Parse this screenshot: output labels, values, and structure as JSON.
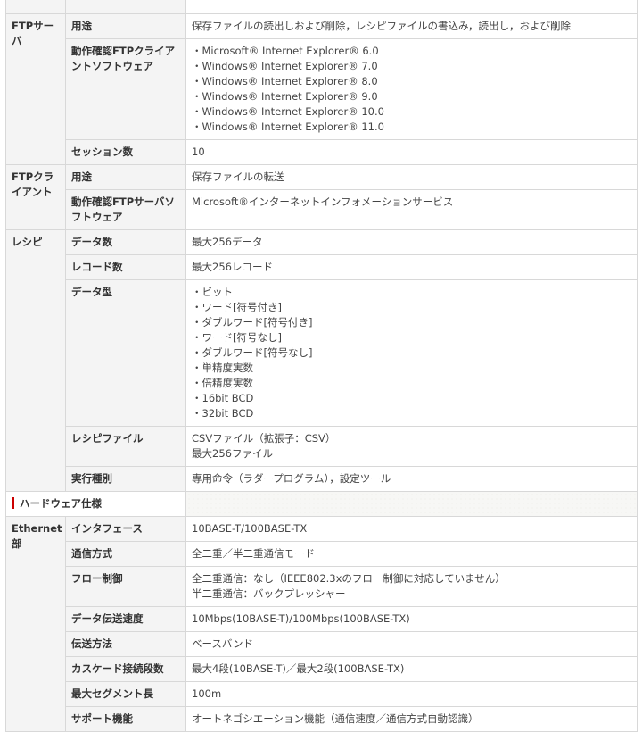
{
  "ftp_server": {
    "category": "FTPサーバ",
    "rows": [
      {
        "label": "用途",
        "lines": [
          "保存ファイルの読出しおよび削除，レシピファイルの書込み，読出し，および削除"
        ]
      },
      {
        "label": "動作確認FTPクライアントソフトウェア",
        "lines": [
          "・Microsoft® Internet Explorer® 6.0",
          "・Windows® Internet Explorer® 7.0",
          "・Windows® Internet Explorer® 8.0",
          "・Windows® Internet Explorer® 9.0",
          "・Windows® Internet Explorer® 10.0",
          "・Windows® Internet Explorer® 11.0"
        ]
      },
      {
        "label": "セッション数",
        "lines": [
          "10"
        ]
      }
    ]
  },
  "ftp_client": {
    "category": "FTPクライアント",
    "rows": [
      {
        "label": "用途",
        "lines": [
          "保存ファイルの転送"
        ]
      },
      {
        "label": "動作確認FTPサーバソフトウェア",
        "lines": [
          "Microsoft®インターネットインフォメーションサービス"
        ]
      }
    ]
  },
  "recipe": {
    "category": "レシピ",
    "rows": [
      {
        "label": "データ数",
        "lines": [
          "最大256データ"
        ]
      },
      {
        "label": "レコード数",
        "lines": [
          "最大256レコード"
        ]
      },
      {
        "label": "データ型",
        "lines": [
          "・ビット",
          "・ワード[符号付き]",
          "・ダブルワード[符号付き]",
          "・ワード[符号なし]",
          "・ダブルワード[符号なし]",
          "・単精度実数",
          "・倍精度実数",
          "・16bit BCD",
          "・32bit BCD"
        ]
      },
      {
        "label": "レシピファイル",
        "lines": [
          "CSVファイル（拡張子：CSV）",
          "最大256ファイル"
        ]
      },
      {
        "label": "実行種別",
        "lines": [
          "専用命令（ラダープログラム），設定ツール"
        ]
      }
    ]
  },
  "hardware_section": {
    "title": "ハードウェア仕様",
    "accent_color": "#cc0000"
  },
  "ethernet": {
    "category": "Ethernet部",
    "rows": [
      {
        "label": "インタフェース",
        "lines": [
          "10BASE-T/100BASE-TX"
        ]
      },
      {
        "label": "通信方式",
        "lines": [
          "全二重／半二重通信モード"
        ]
      },
      {
        "label": "フロー制御",
        "lines": [
          "全二重通信：なし（IEEE802.3xのフロー制御に対応していません）",
          "半二重通信：バックプレッシャー"
        ]
      },
      {
        "label": "データ伝送速度",
        "lines": [
          "10Mbps(10BASE-T)/100Mbps(100BASE-TX)"
        ]
      },
      {
        "label": "伝送方法",
        "lines": [
          "ベースバンド"
        ]
      },
      {
        "label": "カスケード接続段数",
        "lines": [
          "最大4段(10BASE-T)／最大2段(100BASE-TX)"
        ]
      },
      {
        "label": "最大セグメント長",
        "lines": [
          "100m"
        ]
      },
      {
        "label": "サポート機能",
        "lines": [
          "オートネゴシエーション機能（通信速度／通信方式自動認識）"
        ]
      }
    ]
  }
}
